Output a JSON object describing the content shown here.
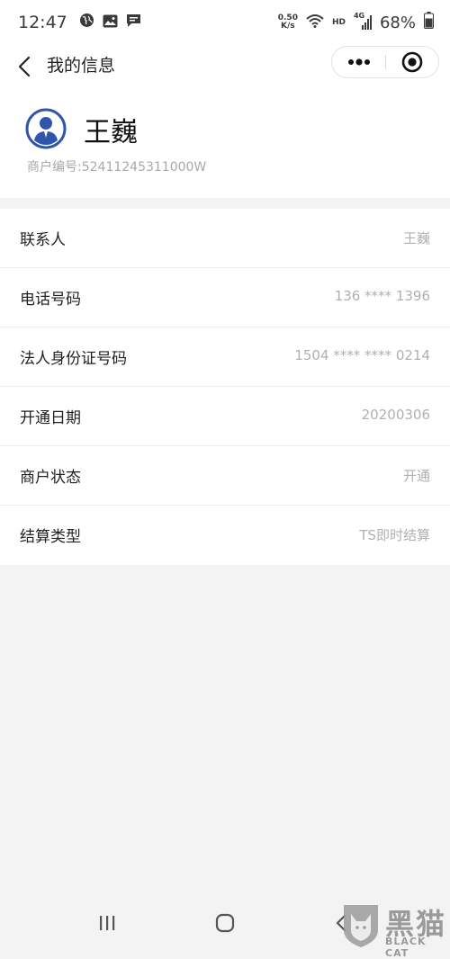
{
  "status_bar": {
    "time": "12:47",
    "net_speed_value": "0.50",
    "net_speed_unit": "K/s",
    "hd_badge": "HD",
    "network_type": "4G",
    "battery_percent": "68%",
    "icons": [
      "globe-icon",
      "image-icon",
      "chat-icon",
      "wifi-icon",
      "signal-icon",
      "battery-icon"
    ]
  },
  "nav": {
    "title": "我的信息",
    "icons": [
      "back-icon",
      "more-icon",
      "close-icon"
    ]
  },
  "profile": {
    "name": "王巍",
    "merchant_id": "商户编号:52411245311000W",
    "avatar_icon": "user-avatar-icon"
  },
  "info_rows": [
    {
      "label": "联系人",
      "value": "王巍"
    },
    {
      "label": "电话号码",
      "value": "136 **** 1396"
    },
    {
      "label": "法人身份证号码",
      "value": "1504 **** **** 0214"
    },
    {
      "label": "开通日期",
      "value": "20200306"
    },
    {
      "label": "商户状态",
      "value": "开通"
    },
    {
      "label": "结算类型",
      "value": "TS即时结算"
    }
  ],
  "system_nav": {
    "icons": [
      "recents-icon",
      "home-icon",
      "back-icon"
    ]
  },
  "watermark": {
    "title": "黑猫",
    "subtitle": "BLACK CAT"
  },
  "colors": {
    "accent_blue": "#2f56a8",
    "page_background": "#f3f3f3",
    "value_gray": "#b0b0b0"
  }
}
